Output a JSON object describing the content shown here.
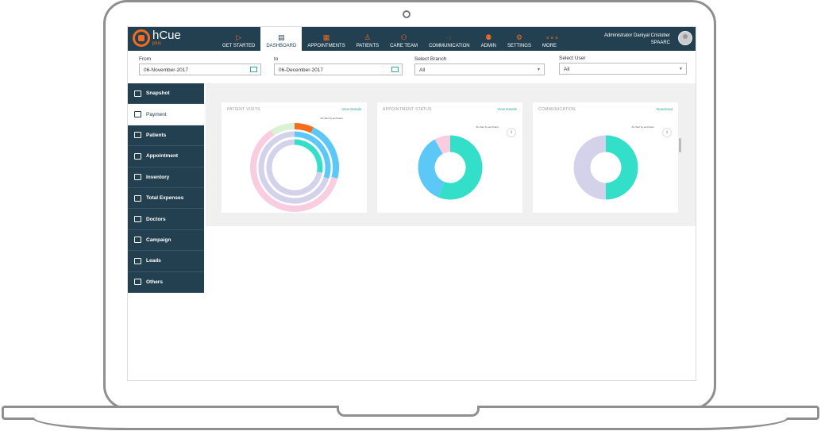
{
  "app": {
    "name": "hCue",
    "sub": "plus"
  },
  "nav": [
    {
      "label": "GET STARTED",
      "icon": "play-icon",
      "active": false
    },
    {
      "label": "DASHBOARD",
      "icon": "dashboard-icon",
      "active": true
    },
    {
      "label": "APPOINTMENTS",
      "icon": "calendar-icon",
      "active": false
    },
    {
      "label": "PATIENTS",
      "icon": "person-icon",
      "active": false
    },
    {
      "label": "CARE TEAM",
      "icon": "team-icon",
      "active": false
    },
    {
      "label": "COMMUNICATION",
      "icon": "chat-icon",
      "active": false
    },
    {
      "label": "ADMIN",
      "icon": "admin-icon",
      "active": false
    },
    {
      "label": "SETTINGS",
      "icon": "gear-icon",
      "active": false
    },
    {
      "label": "MORE",
      "icon": "more-icon",
      "active": false
    }
  ],
  "user": {
    "name": "Administrator Daniyal Cristober",
    "org": "SPAARC"
  },
  "filters": {
    "from_label": "From",
    "from_value": "06-November-2017",
    "to_label": "to",
    "to_value": "06-December-2017",
    "branch_label": "Select Branch",
    "branch_value": "All",
    "user_label": "Select User",
    "user_value": "All"
  },
  "sidebar": [
    {
      "label": "Snapshot",
      "active": false
    },
    {
      "label": "Payment",
      "active": true
    },
    {
      "label": "Patients",
      "active": false
    },
    {
      "label": "Appointment",
      "active": false
    },
    {
      "label": "Inventory",
      "active": false
    },
    {
      "label": "Total Expenses",
      "active": false
    },
    {
      "label": "Doctors",
      "active": false
    },
    {
      "label": "Campaign",
      "active": false
    },
    {
      "label": "Leads",
      "active": false
    },
    {
      "label": "Others",
      "active": false
    }
  ],
  "cards": [
    {
      "title": "PATIENT VISITS",
      "link": "View Details",
      "credit": "JS chart by amCharts"
    },
    {
      "title": "APPOINTMENT STATUS",
      "link": "View Details",
      "credit": "JS chart by amCharts"
    },
    {
      "title": "COMMUNICATION",
      "link": "Download",
      "credit": "JS chart by amCharts"
    }
  ],
  "colors": {
    "primary": "#234050",
    "accent": "#f26b21",
    "teal": "#33dfc8",
    "blue": "#5bc8f8",
    "pink": "#f8cde0",
    "lavender": "#d4d1eb",
    "green": "#d9f2d4",
    "orange": "#f46d1b"
  },
  "chart_data": [
    {
      "type": "pie",
      "title": "PATIENT VISITS",
      "rings": [
        {
          "values": [
            7,
            22,
            62,
            9
          ],
          "colors": [
            "#f46d1b",
            "#5bc8f8",
            "#f8cde0",
            "#d9f2d4"
          ]
        },
        {
          "values": [
            30,
            70
          ],
          "colors": [
            "#5bc8f8",
            "#d4d1eb"
          ]
        },
        {
          "values": [
            28,
            72
          ],
          "colors": [
            "#33dfc8",
            "#d4d1eb"
          ]
        }
      ]
    },
    {
      "type": "pie",
      "title": "APPOINTMENT STATUS",
      "values": [
        56,
        36,
        8
      ],
      "colors": [
        "#33dfc8",
        "#5bc8f8",
        "#f8cde0"
      ]
    },
    {
      "type": "pie",
      "title": "COMMUNICATION",
      "values": [
        50,
        50
      ],
      "colors": [
        "#33dfc8",
        "#d4d1eb"
      ]
    }
  ]
}
